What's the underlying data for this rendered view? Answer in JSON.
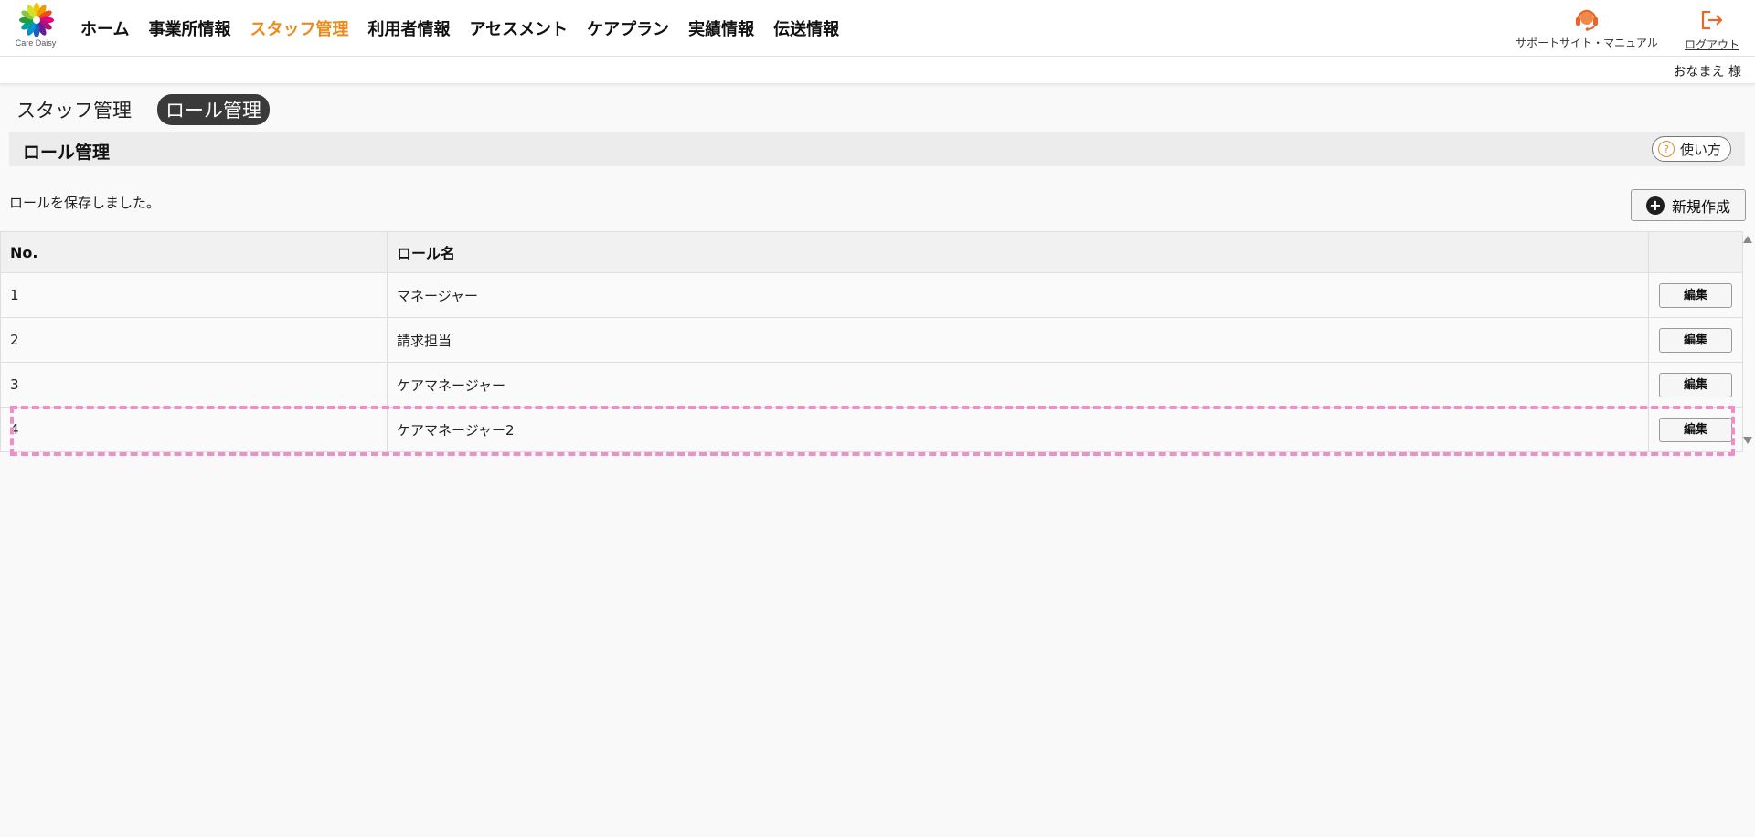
{
  "header": {
    "logo_text": "Care Daisy",
    "nav": [
      "ホーム",
      "事業所情報",
      "スタッフ管理",
      "利用者情報",
      "アセスメント",
      "ケアプラン",
      "実績情報",
      "伝送情報"
    ],
    "support_label": "サポートサイト・マニュアル",
    "logout_label": "ログアウト",
    "accent_color": "#ef8a1a"
  },
  "user": {
    "name": "おなまえ 様"
  },
  "breadcrumb": {
    "parent": "スタッフ管理",
    "current": "ロール管理"
  },
  "section": {
    "title": "ロール管理",
    "help_label": "使い方",
    "help_icon_glyph": "?"
  },
  "message": "ロールを保存しました。",
  "new_button": {
    "label": "新規作成",
    "icon_glyph": "+"
  },
  "table": {
    "headers": [
      "No.",
      "ロール名",
      ""
    ],
    "rows": [
      {
        "no": "1",
        "name": "マネージャー",
        "action": "編集"
      },
      {
        "no": "2",
        "name": "請求担当",
        "action": "編集"
      },
      {
        "no": "3",
        "name": "ケアマネージャー",
        "action": "編集"
      },
      {
        "no": "4",
        "name": "ケアマネージャー2",
        "action": "編集"
      }
    ]
  },
  "icons": {
    "support": "headset-icon",
    "logout": "logout-icon",
    "logo": "daisy-logo-icon"
  }
}
